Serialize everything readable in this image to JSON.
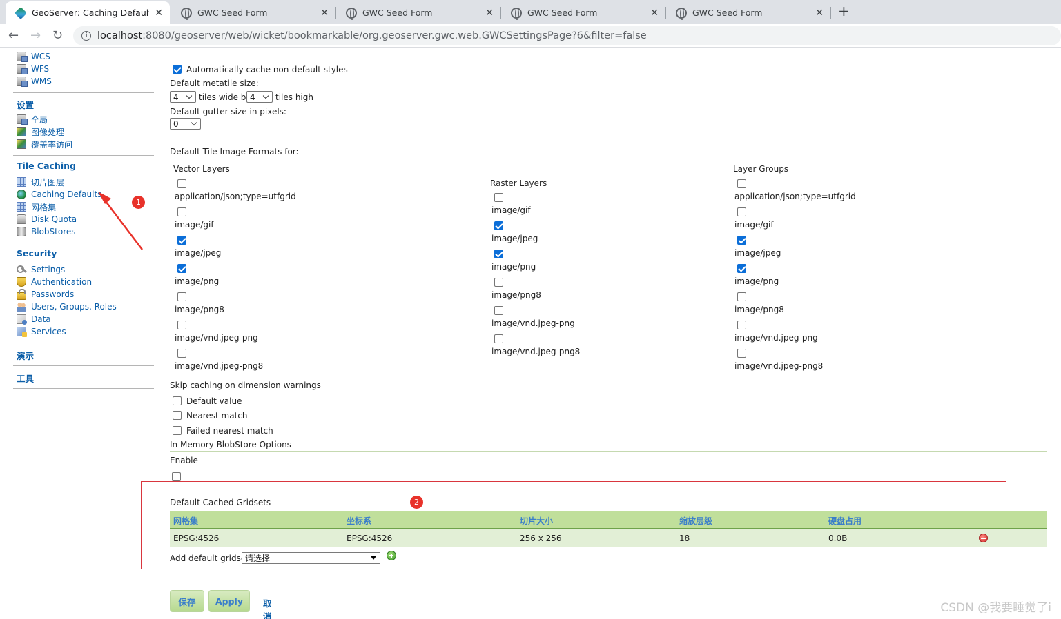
{
  "browser": {
    "tabs": [
      {
        "title": "GeoServer: Caching Defaults",
        "active": true
      },
      {
        "title": "GWC Seed Form"
      },
      {
        "title": "GWC Seed Form"
      },
      {
        "title": "GWC Seed Form"
      },
      {
        "title": "GWC Seed Form"
      }
    ],
    "new_tab": "+",
    "url_host": "localhost",
    "url_rest": ":8080/geoserver/web/wicket/bookmarkable/org.geoserver.gwc.web.GWCSettingsPage?6&filter=false"
  },
  "sidebar": {
    "services": [
      "WCS",
      "WFS",
      "WMS"
    ],
    "settings_head": "设置",
    "settings": [
      "全局",
      "图像处理",
      "覆盖率访问"
    ],
    "tile_head": "Tile Caching",
    "tile": [
      "切片图层",
      "Caching Defaults",
      "网格集",
      "Disk Quota",
      "BlobStores"
    ],
    "security_head": "Security",
    "security": [
      "Settings",
      "Authentication",
      "Passwords",
      "Users, Groups, Roles",
      "Data",
      "Services"
    ],
    "demo_head": "演示",
    "tools_head": "工具"
  },
  "annotations": {
    "badge1": "1",
    "badge2": "2"
  },
  "form": {
    "auto_cache_label": "Automatically cache non-default styles",
    "metatile_label": "Default metatile size:",
    "metatile_wide": "4",
    "tiles_wide_by": "tiles wide by",
    "metatile_high": "4",
    "tiles_high": "tiles high",
    "gutter_label": "Default gutter size in pixels:",
    "gutter_value": "0",
    "formats_label": "Default Tile Image Formats for:",
    "vector_head": "Vector Layers",
    "raster_head": "Raster Layers",
    "group_head": "Layer Groups",
    "vector_formats": [
      {
        "name": "application/json;type=utfgrid",
        "checked": false
      },
      {
        "name": "image/gif",
        "checked": false
      },
      {
        "name": "image/jpeg",
        "checked": true
      },
      {
        "name": "image/png",
        "checked": true
      },
      {
        "name": "image/png8",
        "checked": false
      },
      {
        "name": "image/vnd.jpeg-png",
        "checked": false
      },
      {
        "name": "image/vnd.jpeg-png8",
        "checked": false
      }
    ],
    "raster_formats": [
      {
        "name": "image/gif",
        "checked": false
      },
      {
        "name": "image/jpeg",
        "checked": true
      },
      {
        "name": "image/png",
        "checked": true
      },
      {
        "name": "image/png8",
        "checked": false
      },
      {
        "name": "image/vnd.jpeg-png",
        "checked": false
      },
      {
        "name": "image/vnd.jpeg-png8",
        "checked": false
      }
    ],
    "group_formats": [
      {
        "name": "application/json;type=utfgrid",
        "checked": false
      },
      {
        "name": "image/gif",
        "checked": false
      },
      {
        "name": "image/jpeg",
        "checked": true
      },
      {
        "name": "image/png",
        "checked": true
      },
      {
        "name": "image/png8",
        "checked": false
      },
      {
        "name": "image/vnd.jpeg-png",
        "checked": false
      },
      {
        "name": "image/vnd.jpeg-png8",
        "checked": false
      }
    ],
    "skip_label": "Skip caching on dimension warnings",
    "skip_options": [
      "Default value",
      "Nearest match",
      "Failed nearest match"
    ],
    "memory_label": "In Memory BlobStore Options",
    "enable_label": "Enable",
    "gridsets_label": "Default Cached Gridsets",
    "grid_headers": [
      "网格集",
      "坐标系",
      "切片大小",
      "缩放层级",
      "硬盘占用"
    ],
    "grid_rows": [
      [
        "EPSG:4526",
        "EPSG:4526",
        "256 x 256",
        "18",
        "0.0B"
      ]
    ],
    "add_gridset_label": "Add default gridset",
    "add_gridset_value": "请选择",
    "save": "保存",
    "apply": "Apply",
    "cancel": "取消"
  },
  "watermark": "CSDN @我要睡觉了i"
}
